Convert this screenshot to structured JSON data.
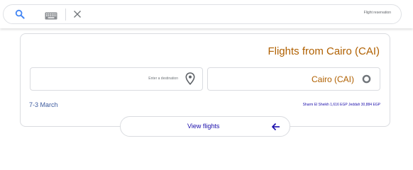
{
  "search": {
    "query": "Flight reservation"
  },
  "card": {
    "title": "Flights from Cairo (CAI)",
    "destination_placeholder": "Enter a destination",
    "origin_value": "Cairo (CAI)",
    "dates": "7-3 March",
    "prices_text": "Sharm El Sheikh 1,616 EGP Jeddah 30,884 EGP"
  },
  "actions": {
    "view_flights_label": "View flights"
  },
  "colors": {
    "accent_orange": "#b06000",
    "link_blue": "#1a0dab",
    "search_blue": "#4285f4",
    "border": "#dadce0"
  },
  "icons": {
    "search": "search-icon",
    "keyboard": "keyboard-icon",
    "clear": "close-icon",
    "location": "location-pin-icon",
    "origin": "origin-ring-icon",
    "arrow": "arrow-left-icon"
  }
}
